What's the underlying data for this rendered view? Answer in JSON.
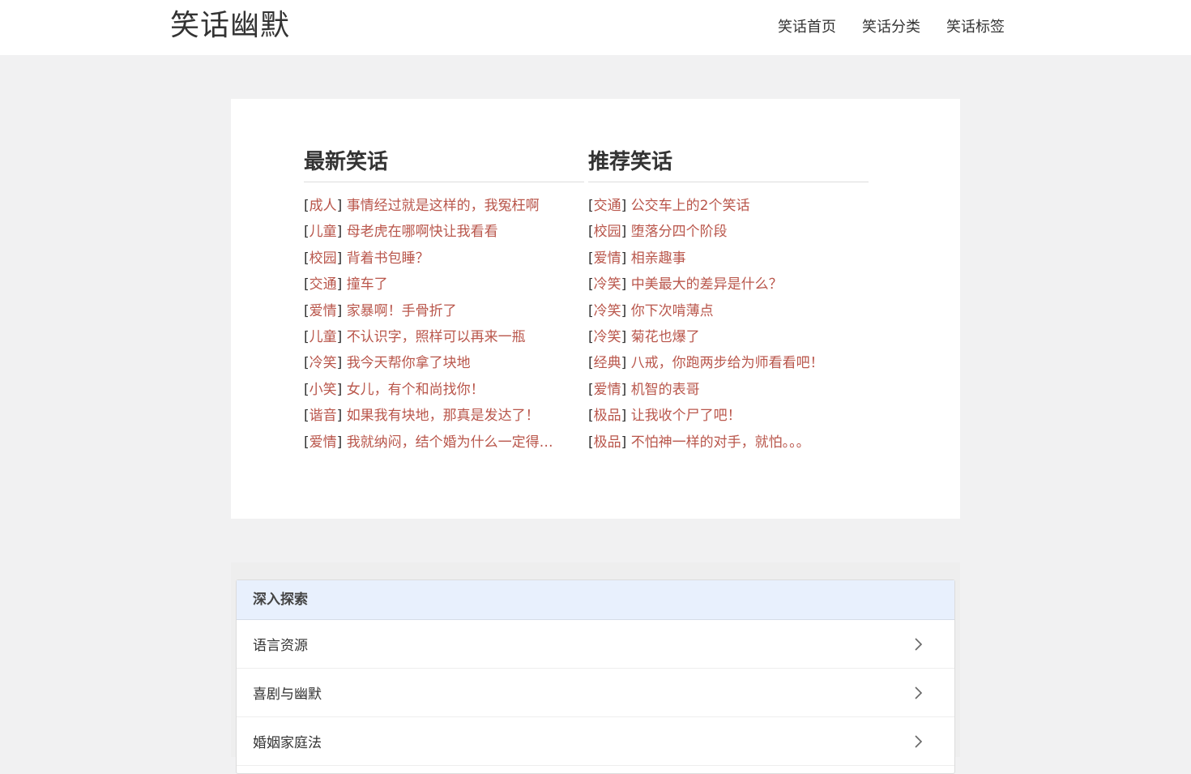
{
  "header": {
    "logo": "笑话幽默",
    "nav": [
      "笑话首页",
      "笑话分类",
      "笑话标签"
    ]
  },
  "latest": {
    "heading": "最新笑话",
    "items": [
      {
        "cat": "成人",
        "title": "事情经过就是这样的，我冤枉啊"
      },
      {
        "cat": "儿童",
        "title": "母老虎在哪啊快让我看看"
      },
      {
        "cat": "校园",
        "title": "背着书包睡？"
      },
      {
        "cat": "交通",
        "title": "撞车了"
      },
      {
        "cat": "爱情",
        "title": "家暴啊！手骨折了"
      },
      {
        "cat": "儿童",
        "title": "不认识字，照样可以再来一瓶"
      },
      {
        "cat": "冷笑",
        "title": "我今天帮你拿了块地"
      },
      {
        "cat": "小笑",
        "title": "女儿，有个和尚找你！"
      },
      {
        "cat": "谐音",
        "title": "如果我有块地，那真是发达了！"
      },
      {
        "cat": "爱情",
        "title": "我就纳闷，结个婚为什么一定得…"
      }
    ]
  },
  "recommended": {
    "heading": "推荐笑话",
    "items": [
      {
        "cat": "交通",
        "title": "公交车上的2个笑话"
      },
      {
        "cat": "校园",
        "title": "堕落分四个阶段"
      },
      {
        "cat": "爱情",
        "title": "相亲趣事"
      },
      {
        "cat": "冷笑",
        "title": "中美最大的差异是什么？"
      },
      {
        "cat": "冷笑",
        "title": "你下次啃薄点"
      },
      {
        "cat": "冷笑",
        "title": "菊花也爆了"
      },
      {
        "cat": "经典",
        "title": "八戒，你跑两步给为师看看吧！"
      },
      {
        "cat": "爱情",
        "title": "机智的表哥"
      },
      {
        "cat": "极品",
        "title": "让我收个尸了吧！"
      },
      {
        "cat": "极品",
        "title": "不怕神一样的对手，就怕。。。"
      }
    ]
  },
  "explore": {
    "heading": "深入探索",
    "items": [
      "语言资源",
      "喜剧与幽默",
      "婚姻家庭法"
    ]
  },
  "icons": {
    "chevron": "chevron-right-icon"
  },
  "colors": {
    "link": "#b9564b",
    "background": "#f1f1f2",
    "explore_header": "#e8f0fd"
  }
}
